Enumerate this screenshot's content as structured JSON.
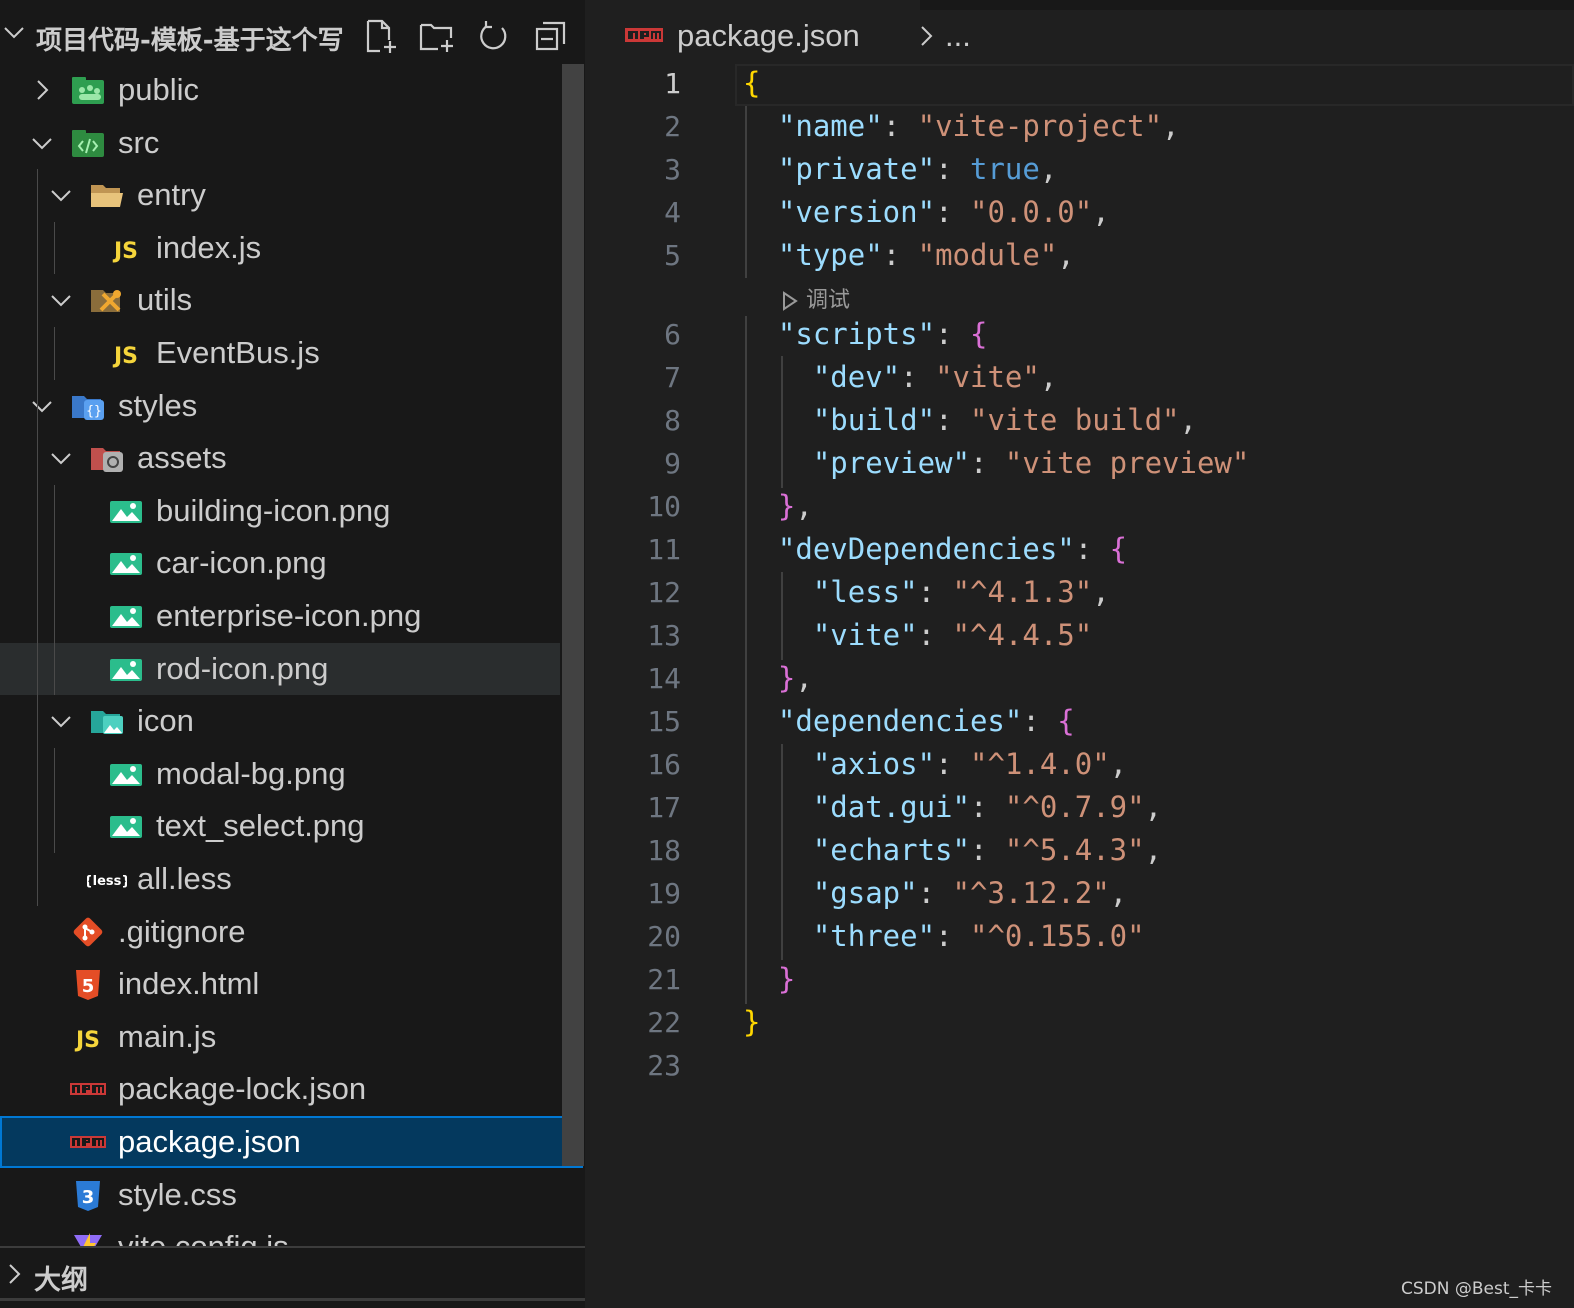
{
  "explorer": {
    "folder_title": "项目代码-模板-基于这个写",
    "actions": [
      "new-file",
      "new-folder",
      "refresh",
      "collapse-all"
    ],
    "items": [
      {
        "label": "public",
        "depth": 0,
        "type": "folder",
        "expanded": false,
        "icon": "public-folder-icon"
      },
      {
        "label": "src",
        "depth": 0,
        "type": "folder",
        "expanded": true,
        "icon": "src-folder-icon"
      },
      {
        "label": "entry",
        "depth": 1,
        "type": "folder",
        "expanded": true,
        "icon": "folder-open-icon"
      },
      {
        "label": "index.js",
        "depth": 2,
        "type": "file",
        "icon": "js-icon"
      },
      {
        "label": "utils",
        "depth": 1,
        "type": "folder",
        "expanded": true,
        "icon": "utils-folder-icon"
      },
      {
        "label": "EventBus.js",
        "depth": 2,
        "type": "file",
        "icon": "js-icon"
      },
      {
        "label": "styles",
        "depth": 0,
        "type": "folder",
        "expanded": true,
        "icon": "styles-folder-icon"
      },
      {
        "label": "assets",
        "depth": 1,
        "type": "folder",
        "expanded": true,
        "icon": "assets-folder-icon"
      },
      {
        "label": "building-icon.png",
        "depth": 2,
        "type": "file",
        "icon": "image-icon"
      },
      {
        "label": "car-icon.png",
        "depth": 2,
        "type": "file",
        "icon": "image-icon"
      },
      {
        "label": "enterprise-icon.png",
        "depth": 2,
        "type": "file",
        "icon": "image-icon"
      },
      {
        "label": "rod-icon.png",
        "depth": 2,
        "type": "file",
        "icon": "image-icon",
        "hovered": true
      },
      {
        "label": "icon",
        "depth": 1,
        "type": "folder",
        "expanded": true,
        "icon": "images-folder-icon"
      },
      {
        "label": "modal-bg.png",
        "depth": 2,
        "type": "file",
        "icon": "image-icon"
      },
      {
        "label": "text_select.png",
        "depth": 2,
        "type": "file",
        "icon": "image-icon"
      },
      {
        "label": "all.less",
        "depth": 1,
        "type": "file",
        "icon": "less-icon"
      },
      {
        "label": ".gitignore",
        "depth": 0,
        "type": "file",
        "icon": "git-icon"
      },
      {
        "label": "index.html",
        "depth": 0,
        "type": "file",
        "icon": "html5-icon"
      },
      {
        "label": "main.js",
        "depth": 0,
        "type": "file",
        "icon": "js-icon"
      },
      {
        "label": "package-lock.json",
        "depth": 0,
        "type": "file",
        "icon": "npm-icon"
      },
      {
        "label": "package.json",
        "depth": 0,
        "type": "file",
        "icon": "npm-icon",
        "selected": true
      },
      {
        "label": "style.css",
        "depth": 0,
        "type": "file",
        "icon": "css3-icon"
      },
      {
        "label": "vite.config.js",
        "depth": 0,
        "type": "file",
        "icon": "vite-icon",
        "clipped": true
      }
    ]
  },
  "outline": {
    "title": "大纲"
  },
  "editor": {
    "breadcrumb": {
      "file": "package.json",
      "more": "..."
    },
    "codelens": "调试",
    "lines": [
      {
        "n": "1",
        "tokens": [
          [
            "br1",
            "{"
          ]
        ]
      },
      {
        "n": "2",
        "tokens": [
          [
            "p",
            "  "
          ],
          [
            "k",
            "\"name\""
          ],
          [
            "p",
            ": "
          ],
          [
            "s",
            "\"vite-project\""
          ],
          [
            "p",
            ","
          ]
        ]
      },
      {
        "n": "3",
        "tokens": [
          [
            "p",
            "  "
          ],
          [
            "k",
            "\"private\""
          ],
          [
            "p",
            ": "
          ],
          [
            "b",
            "true"
          ],
          [
            "p",
            ","
          ]
        ]
      },
      {
        "n": "4",
        "tokens": [
          [
            "p",
            "  "
          ],
          [
            "k",
            "\"version\""
          ],
          [
            "p",
            ": "
          ],
          [
            "s",
            "\"0.0.0\""
          ],
          [
            "p",
            ","
          ]
        ]
      },
      {
        "n": "5",
        "tokens": [
          [
            "p",
            "  "
          ],
          [
            "k",
            "\"type\""
          ],
          [
            "p",
            ": "
          ],
          [
            "s",
            "\"module\""
          ],
          [
            "p",
            ","
          ]
        ]
      },
      {
        "n": "6",
        "tokens": [
          [
            "p",
            "  "
          ],
          [
            "k",
            "\"scripts\""
          ],
          [
            "p",
            ": "
          ],
          [
            "br2",
            "{"
          ]
        ]
      },
      {
        "n": "7",
        "tokens": [
          [
            "p",
            "    "
          ],
          [
            "k",
            "\"dev\""
          ],
          [
            "p",
            ": "
          ],
          [
            "s",
            "\"vite\""
          ],
          [
            "p",
            ","
          ]
        ]
      },
      {
        "n": "8",
        "tokens": [
          [
            "p",
            "    "
          ],
          [
            "k",
            "\"build\""
          ],
          [
            "p",
            ": "
          ],
          [
            "s",
            "\"vite build\""
          ],
          [
            "p",
            ","
          ]
        ]
      },
      {
        "n": "9",
        "tokens": [
          [
            "p",
            "    "
          ],
          [
            "k",
            "\"preview\""
          ],
          [
            "p",
            ": "
          ],
          [
            "s",
            "\"vite preview\""
          ]
        ]
      },
      {
        "n": "10",
        "tokens": [
          [
            "p",
            "  "
          ],
          [
            "br2",
            "}"
          ],
          [
            "p",
            ","
          ]
        ]
      },
      {
        "n": "11",
        "tokens": [
          [
            "p",
            "  "
          ],
          [
            "k",
            "\"devDependencies\""
          ],
          [
            "p",
            ": "
          ],
          [
            "br2",
            "{"
          ]
        ]
      },
      {
        "n": "12",
        "tokens": [
          [
            "p",
            "    "
          ],
          [
            "k",
            "\"less\""
          ],
          [
            "p",
            ": "
          ],
          [
            "s",
            "\"^4.1.3\""
          ],
          [
            "p",
            ","
          ]
        ]
      },
      {
        "n": "13",
        "tokens": [
          [
            "p",
            "    "
          ],
          [
            "k",
            "\"vite\""
          ],
          [
            "p",
            ": "
          ],
          [
            "s",
            "\"^4.4.5\""
          ]
        ]
      },
      {
        "n": "14",
        "tokens": [
          [
            "p",
            "  "
          ],
          [
            "br2",
            "}"
          ],
          [
            "p",
            ","
          ]
        ]
      },
      {
        "n": "15",
        "tokens": [
          [
            "p",
            "  "
          ],
          [
            "k",
            "\"dependencies\""
          ],
          [
            "p",
            ": "
          ],
          [
            "br2",
            "{"
          ]
        ]
      },
      {
        "n": "16",
        "tokens": [
          [
            "p",
            "    "
          ],
          [
            "k",
            "\"axios\""
          ],
          [
            "p",
            ": "
          ],
          [
            "s",
            "\"^1.4.0\""
          ],
          [
            "p",
            ","
          ]
        ]
      },
      {
        "n": "17",
        "tokens": [
          [
            "p",
            "    "
          ],
          [
            "k",
            "\"dat.gui\""
          ],
          [
            "p",
            ": "
          ],
          [
            "s",
            "\"^0.7.9\""
          ],
          [
            "p",
            ","
          ]
        ]
      },
      {
        "n": "18",
        "tokens": [
          [
            "p",
            "    "
          ],
          [
            "k",
            "\"echarts\""
          ],
          [
            "p",
            ": "
          ],
          [
            "s",
            "\"^5.4.3\""
          ],
          [
            "p",
            ","
          ]
        ]
      },
      {
        "n": "19",
        "tokens": [
          [
            "p",
            "    "
          ],
          [
            "k",
            "\"gsap\""
          ],
          [
            "p",
            ": "
          ],
          [
            "s",
            "\"^3.12.2\""
          ],
          [
            "p",
            ","
          ]
        ]
      },
      {
        "n": "20",
        "tokens": [
          [
            "p",
            "    "
          ],
          [
            "k",
            "\"three\""
          ],
          [
            "p",
            ": "
          ],
          [
            "s",
            "\"^0.155.0\""
          ]
        ]
      },
      {
        "n": "21",
        "tokens": [
          [
            "p",
            "  "
          ],
          [
            "br2",
            "}"
          ]
        ]
      },
      {
        "n": "22",
        "tokens": [
          [
            "br1",
            "}"
          ]
        ]
      },
      {
        "n": "23",
        "tokens": []
      }
    ],
    "active_line": "1"
  },
  "watermark": "CSDN @Best_卡卡",
  "colors": {
    "sidebar_bg": "#181818",
    "editor_bg": "#1f1f1f",
    "selection_bg": "#04395e",
    "selection_border": "#0078d4",
    "key": "#9cdcfe",
    "string": "#ce9178",
    "boolean": "#569cd6",
    "bracket_level1": "#ffd700",
    "bracket_level2": "#da70d6"
  }
}
